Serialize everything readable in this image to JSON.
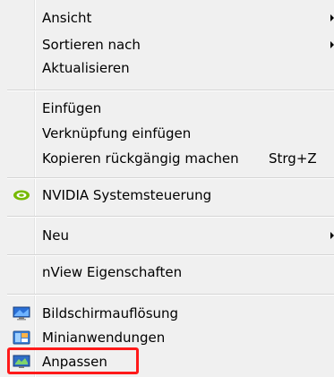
{
  "menu": {
    "items": [
      {
        "label": "Ansicht",
        "submenu": true
      },
      {
        "label": "Sortieren nach",
        "submenu": true
      },
      {
        "label": "Aktualisieren"
      },
      {
        "label": "Einfügen"
      },
      {
        "label": "Verknüpfung einfügen"
      },
      {
        "label": "Kopieren rückgängig machen",
        "shortcut": "Strg+Z"
      },
      {
        "label": "NVIDIA Systemsteuerung",
        "icon": "nvidia-icon"
      },
      {
        "label": "Neu",
        "submenu": true
      },
      {
        "label": "nView Eigenschaften"
      },
      {
        "label": "Bildschirmauflösung",
        "icon": "display-resolution-icon"
      },
      {
        "label": "Minianwendungen",
        "icon": "gadgets-icon"
      },
      {
        "label": "Anpassen",
        "icon": "personalize-icon",
        "highlighted": true
      }
    ]
  },
  "colors": {
    "menu_background": "#f0f0f0",
    "highlight_border": "#ff1a1a",
    "nvidia_green": "#76b900"
  }
}
